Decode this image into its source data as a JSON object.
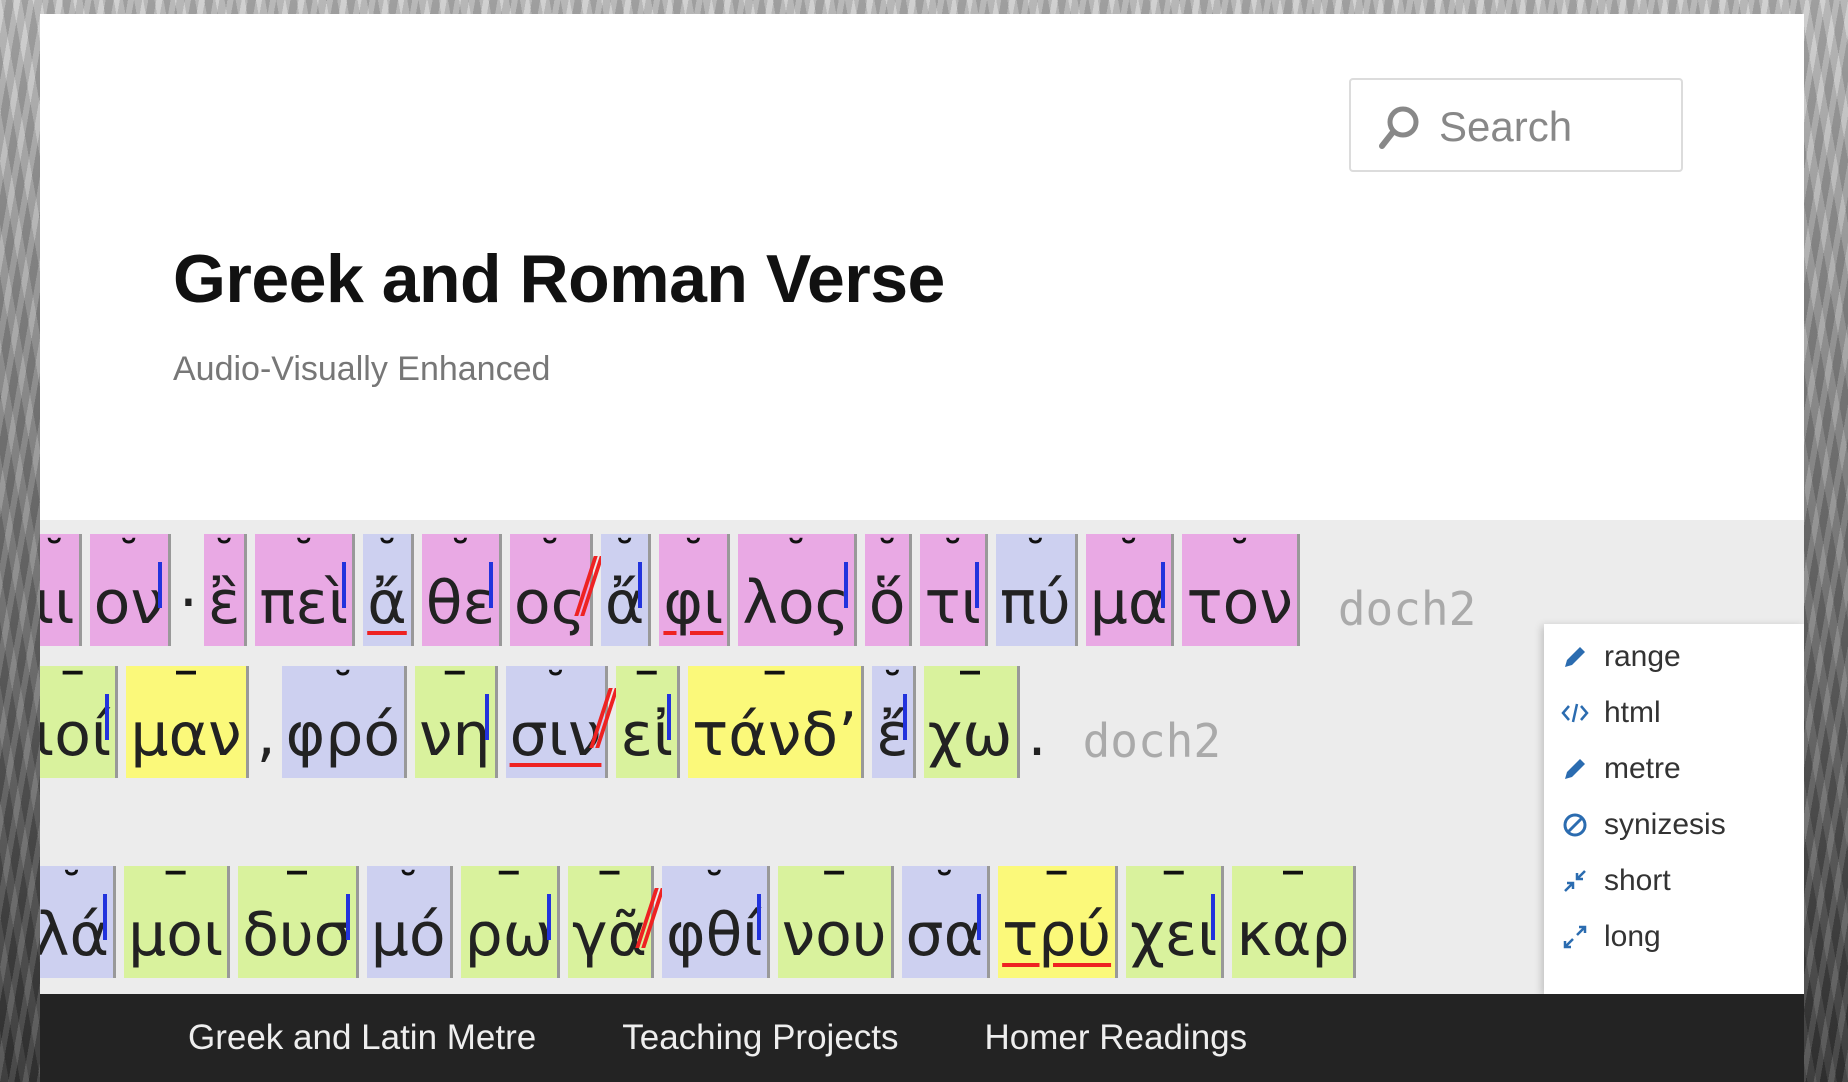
{
  "search": {
    "placeholder": "Search"
  },
  "site": {
    "title": "Greek and Roman Verse",
    "description": "Audio-Visually Enhanced"
  },
  "scansion": {
    "line1": {
      "syllables": [
        "ιι",
        "ον",
        "ἒ",
        "πεὶ",
        "ἄ",
        "θε",
        "ος",
        "ἄ",
        "φι",
        "λος",
        "ὅ",
        "τι",
        "πύ",
        "μα",
        "τον"
      ],
      "punct_after_2": "·",
      "meter": "doch2"
    },
    "line2": {
      "syllables": [
        "ιοί",
        "μαν",
        "φρό",
        "νη",
        "σιν",
        "εἰ",
        "τάνδ’",
        "ἔ",
        "χω"
      ],
      "punct_comma": ",",
      "punct_end": ".",
      "meter": "doch2"
    },
    "line3": {
      "syllables": [
        "λά",
        "μοι",
        "δυσ",
        "μό",
        "ρω",
        "γᾶ",
        "φθί",
        "νου",
        "σα",
        "τρύ",
        "χει",
        "καρ"
      ]
    }
  },
  "context_menu": {
    "items": [
      {
        "label": "range",
        "icon": "pencil-icon"
      },
      {
        "label": "html",
        "icon": "code-icon"
      },
      {
        "label": "metre",
        "icon": "pencil-icon"
      },
      {
        "label": "synizesis",
        "icon": "prohibited-icon"
      },
      {
        "label": "short",
        "icon": "collapse-icon"
      },
      {
        "label": "long",
        "icon": "expand-icon"
      }
    ],
    "icon_color": "#2b6cb0"
  },
  "nav": {
    "items": [
      "Greek and Latin Metre",
      "Teaching Projects",
      "Homer Readings"
    ]
  }
}
